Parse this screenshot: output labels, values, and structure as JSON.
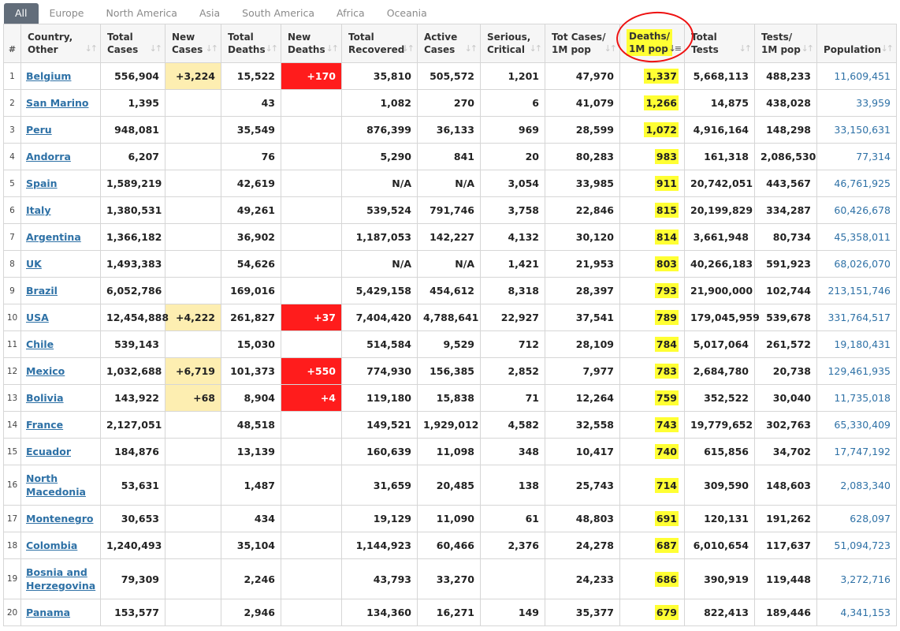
{
  "tabs": [
    "All",
    "Europe",
    "North America",
    "Asia",
    "South America",
    "Africa",
    "Oceania"
  ],
  "headers": {
    "num": "#",
    "country": [
      "Country,",
      "Other"
    ],
    "total_cases": [
      "Total",
      "Cases"
    ],
    "new_cases": [
      "New",
      "Cases"
    ],
    "total_deaths": [
      "Total",
      "Deaths"
    ],
    "new_deaths": [
      "New",
      "Deaths"
    ],
    "total_recovered": [
      "Total",
      "Recovered"
    ],
    "active_cases": [
      "Active",
      "Cases"
    ],
    "serious": [
      "Serious,",
      "Critical"
    ],
    "cases_per_m": [
      "Tot Cases/",
      "1M pop"
    ],
    "deaths_per_m": [
      "Deaths/",
      "1M pop"
    ],
    "total_tests": [
      "Total",
      "Tests"
    ],
    "tests_per_m": [
      "Tests/",
      "1M pop"
    ],
    "population": "Population"
  },
  "colors": {
    "highlight": "#ffff33",
    "new_cases_bg": "#fdeeb1",
    "new_deaths_bg": "#ff1c1c",
    "link": "#2e71a6",
    "annotation_circle": "#e11111"
  },
  "rows": [
    {
      "num": "1",
      "country": "Belgium",
      "total_cases": "556,904",
      "new_cases": "+3,224",
      "total_deaths": "15,522",
      "new_deaths": "+170",
      "total_recovered": "35,810",
      "active_cases": "505,572",
      "serious": "1,201",
      "cases_per_m": "47,970",
      "deaths_per_m": "1,337",
      "total_tests": "5,668,113",
      "tests_per_m": "488,233",
      "population": "11,609,451"
    },
    {
      "num": "2",
      "country": "San Marino",
      "total_cases": "1,395",
      "new_cases": "",
      "total_deaths": "43",
      "new_deaths": "",
      "total_recovered": "1,082",
      "active_cases": "270",
      "serious": "6",
      "cases_per_m": "41,079",
      "deaths_per_m": "1,266",
      "total_tests": "14,875",
      "tests_per_m": "438,028",
      "population": "33,959"
    },
    {
      "num": "3",
      "country": "Peru",
      "total_cases": "948,081",
      "new_cases": "",
      "total_deaths": "35,549",
      "new_deaths": "",
      "total_recovered": "876,399",
      "active_cases": "36,133",
      "serious": "969",
      "cases_per_m": "28,599",
      "deaths_per_m": "1,072",
      "total_tests": "4,916,164",
      "tests_per_m": "148,298",
      "population": "33,150,631"
    },
    {
      "num": "4",
      "country": "Andorra",
      "total_cases": "6,207",
      "new_cases": "",
      "total_deaths": "76",
      "new_deaths": "",
      "total_recovered": "5,290",
      "active_cases": "841",
      "serious": "20",
      "cases_per_m": "80,283",
      "deaths_per_m": "983",
      "total_tests": "161,318",
      "tests_per_m": "2,086,530",
      "population": "77,314"
    },
    {
      "num": "5",
      "country": "Spain",
      "total_cases": "1,589,219",
      "new_cases": "",
      "total_deaths": "42,619",
      "new_deaths": "",
      "total_recovered": "N/A",
      "active_cases": "N/A",
      "serious": "3,054",
      "cases_per_m": "33,985",
      "deaths_per_m": "911",
      "total_tests": "20,742,051",
      "tests_per_m": "443,567",
      "population": "46,761,925"
    },
    {
      "num": "6",
      "country": "Italy",
      "total_cases": "1,380,531",
      "new_cases": "",
      "total_deaths": "49,261",
      "new_deaths": "",
      "total_recovered": "539,524",
      "active_cases": "791,746",
      "serious": "3,758",
      "cases_per_m": "22,846",
      "deaths_per_m": "815",
      "total_tests": "20,199,829",
      "tests_per_m": "334,287",
      "population": "60,426,678"
    },
    {
      "num": "7",
      "country": "Argentina",
      "total_cases": "1,366,182",
      "new_cases": "",
      "total_deaths": "36,902",
      "new_deaths": "",
      "total_recovered": "1,187,053",
      "active_cases": "142,227",
      "serious": "4,132",
      "cases_per_m": "30,120",
      "deaths_per_m": "814",
      "total_tests": "3,661,948",
      "tests_per_m": "80,734",
      "population": "45,358,011"
    },
    {
      "num": "8",
      "country": "UK",
      "total_cases": "1,493,383",
      "new_cases": "",
      "total_deaths": "54,626",
      "new_deaths": "",
      "total_recovered": "N/A",
      "active_cases": "N/A",
      "serious": "1,421",
      "cases_per_m": "21,953",
      "deaths_per_m": "803",
      "total_tests": "40,266,183",
      "tests_per_m": "591,923",
      "population": "68,026,070"
    },
    {
      "num": "9",
      "country": "Brazil",
      "total_cases": "6,052,786",
      "new_cases": "",
      "total_deaths": "169,016",
      "new_deaths": "",
      "total_recovered": "5,429,158",
      "active_cases": "454,612",
      "serious": "8,318",
      "cases_per_m": "28,397",
      "deaths_per_m": "793",
      "total_tests": "21,900,000",
      "tests_per_m": "102,744",
      "population": "213,151,746"
    },
    {
      "num": "10",
      "country": "USA",
      "total_cases": "12,454,888",
      "new_cases": "+4,222",
      "total_deaths": "261,827",
      "new_deaths": "+37",
      "total_recovered": "7,404,420",
      "active_cases": "4,788,641",
      "serious": "22,927",
      "cases_per_m": "37,541",
      "deaths_per_m": "789",
      "total_tests": "179,045,959",
      "tests_per_m": "539,678",
      "population": "331,764,517"
    },
    {
      "num": "11",
      "country": "Chile",
      "total_cases": "539,143",
      "new_cases": "",
      "total_deaths": "15,030",
      "new_deaths": "",
      "total_recovered": "514,584",
      "active_cases": "9,529",
      "serious": "712",
      "cases_per_m": "28,109",
      "deaths_per_m": "784",
      "total_tests": "5,017,064",
      "tests_per_m": "261,572",
      "population": "19,180,431"
    },
    {
      "num": "12",
      "country": "Mexico",
      "total_cases": "1,032,688",
      "new_cases": "+6,719",
      "total_deaths": "101,373",
      "new_deaths": "+550",
      "total_recovered": "774,930",
      "active_cases": "156,385",
      "serious": "2,852",
      "cases_per_m": "7,977",
      "deaths_per_m": "783",
      "total_tests": "2,684,780",
      "tests_per_m": "20,738",
      "population": "129,461,935"
    },
    {
      "num": "13",
      "country": "Bolivia",
      "total_cases": "143,922",
      "new_cases": "+68",
      "total_deaths": "8,904",
      "new_deaths": "+4",
      "total_recovered": "119,180",
      "active_cases": "15,838",
      "serious": "71",
      "cases_per_m": "12,264",
      "deaths_per_m": "759",
      "total_tests": "352,522",
      "tests_per_m": "30,040",
      "population": "11,735,018"
    },
    {
      "num": "14",
      "country": "France",
      "total_cases": "2,127,051",
      "new_cases": "",
      "total_deaths": "48,518",
      "new_deaths": "",
      "total_recovered": "149,521",
      "active_cases": "1,929,012",
      "serious": "4,582",
      "cases_per_m": "32,558",
      "deaths_per_m": "743",
      "total_tests": "19,779,652",
      "tests_per_m": "302,763",
      "population": "65,330,409"
    },
    {
      "num": "15",
      "country": "Ecuador",
      "total_cases": "184,876",
      "new_cases": "",
      "total_deaths": "13,139",
      "new_deaths": "",
      "total_recovered": "160,639",
      "active_cases": "11,098",
      "serious": "348",
      "cases_per_m": "10,417",
      "deaths_per_m": "740",
      "total_tests": "615,856",
      "tests_per_m": "34,702",
      "population": "17,747,192"
    },
    {
      "num": "16",
      "country": "North Macedonia",
      "total_cases": "53,631",
      "new_cases": "",
      "total_deaths": "1,487",
      "new_deaths": "",
      "total_recovered": "31,659",
      "active_cases": "20,485",
      "serious": "138",
      "cases_per_m": "25,743",
      "deaths_per_m": "714",
      "total_tests": "309,590",
      "tests_per_m": "148,603",
      "population": "2,083,340"
    },
    {
      "num": "17",
      "country": "Montenegro",
      "total_cases": "30,653",
      "new_cases": "",
      "total_deaths": "434",
      "new_deaths": "",
      "total_recovered": "19,129",
      "active_cases": "11,090",
      "serious": "61",
      "cases_per_m": "48,803",
      "deaths_per_m": "691",
      "total_tests": "120,131",
      "tests_per_m": "191,262",
      "population": "628,097"
    },
    {
      "num": "18",
      "country": "Colombia",
      "total_cases": "1,240,493",
      "new_cases": "",
      "total_deaths": "35,104",
      "new_deaths": "",
      "total_recovered": "1,144,923",
      "active_cases": "60,466",
      "serious": "2,376",
      "cases_per_m": "24,278",
      "deaths_per_m": "687",
      "total_tests": "6,010,654",
      "tests_per_m": "117,637",
      "population": "51,094,723"
    },
    {
      "num": "19",
      "country": "Bosnia and Herzegovina",
      "total_cases": "79,309",
      "new_cases": "",
      "total_deaths": "2,246",
      "new_deaths": "",
      "total_recovered": "43,793",
      "active_cases": "33,270",
      "serious": "",
      "cases_per_m": "24,233",
      "deaths_per_m": "686",
      "total_tests": "390,919",
      "tests_per_m": "119,448",
      "population": "3,272,716"
    },
    {
      "num": "20",
      "country": "Panama",
      "total_cases": "153,577",
      "new_cases": "",
      "total_deaths": "2,946",
      "new_deaths": "",
      "total_recovered": "134,360",
      "active_cases": "16,271",
      "serious": "149",
      "cases_per_m": "35,377",
      "deaths_per_m": "679",
      "total_tests": "822,413",
      "tests_per_m": "189,446",
      "population": "4,341,153"
    }
  ]
}
